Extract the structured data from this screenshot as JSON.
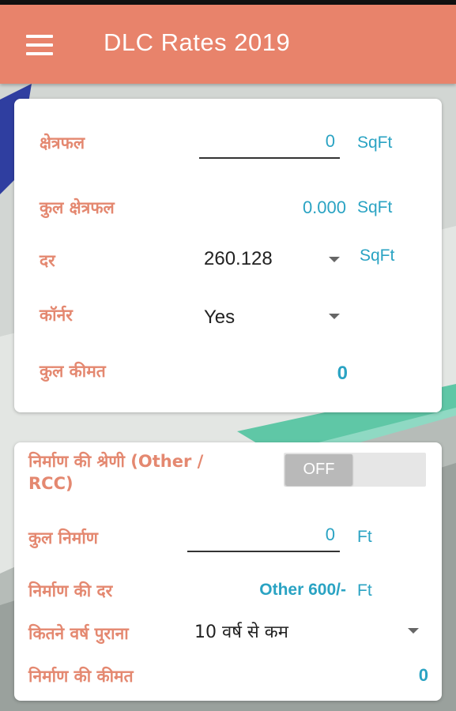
{
  "app_bar": {
    "title": "DLC Rates 2019",
    "menu_icon": "hamburger-menu-icon"
  },
  "colors": {
    "app_bar": "#e8836b",
    "label": "#e48870",
    "accent": "#2aa3c3"
  },
  "land": {
    "area_label": "क्षेत्रफल",
    "area_value": "0",
    "area_unit": "SqFt",
    "total_area_label": "कुल क्षेत्रफल",
    "total_area_value": "0.000",
    "total_area_unit": "SqFt",
    "rate_label": "दर",
    "rate_selected": "260.128",
    "rate_unit": "SqFt",
    "corner_label": "कॉर्नर",
    "corner_selected": "Yes",
    "total_price_label": "कुल कीमत",
    "total_price_value": "0"
  },
  "construction": {
    "category_label": "निर्माण की श्रेणी (Other / RCC)",
    "category_toggle": "OFF",
    "total_label": "कुल निर्माण",
    "total_value": "0",
    "total_unit": "Ft",
    "rate_label": "निर्माण की दर",
    "rate_value": "Other 600/-",
    "rate_unit": "Ft",
    "age_label": "कितने वर्ष पुराना",
    "age_selected": "10 वर्ष से कम",
    "price_label": "निर्माण की कीमत",
    "price_value": "0"
  }
}
